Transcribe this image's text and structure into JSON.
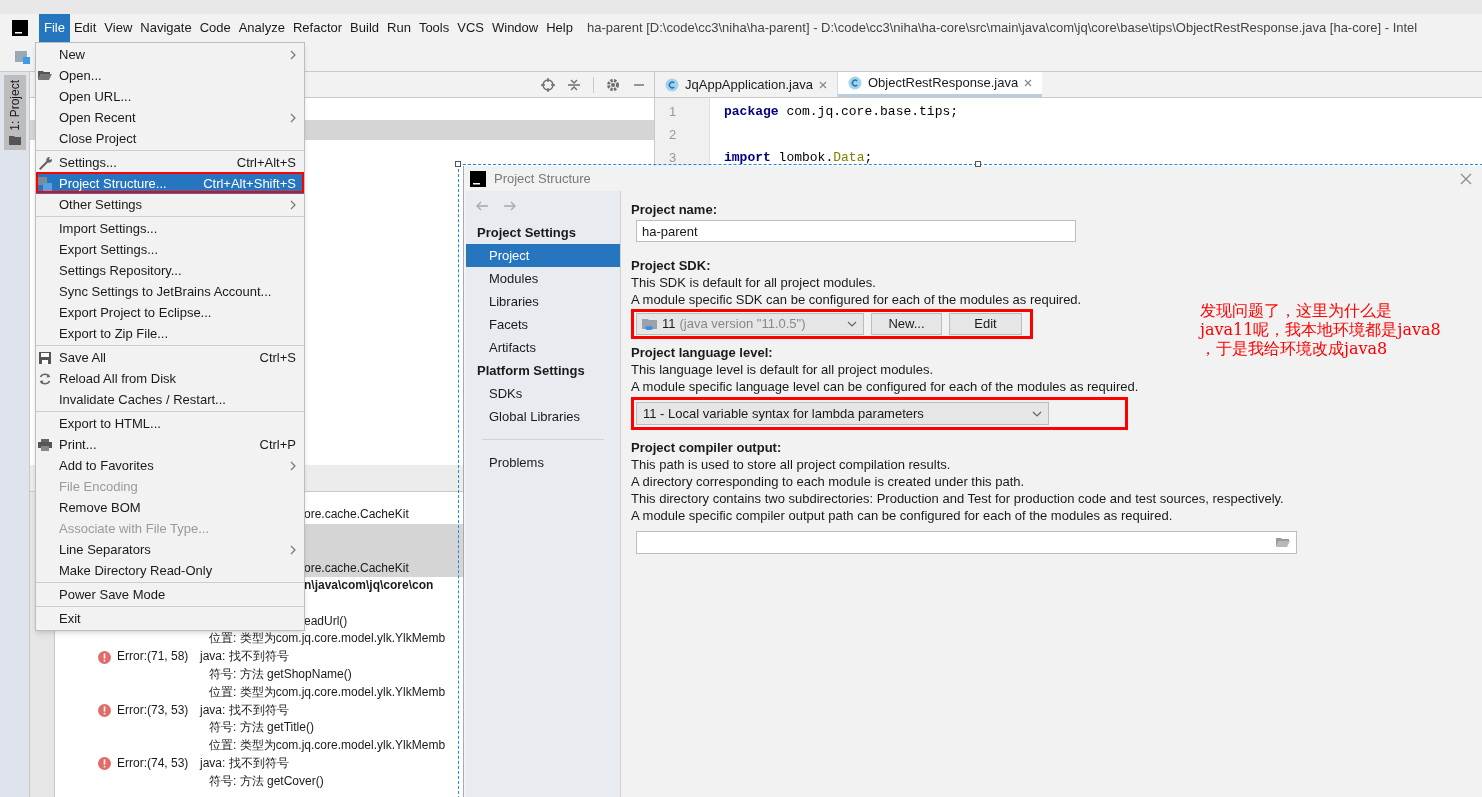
{
  "window": {
    "title": "ha-parent [D:\\code\\cc3\\niha\\ha-parent] - D:\\code\\cc3\\niha\\ha-core\\src\\main\\java\\com\\jq\\core\\base\\tips\\ObjectRestResponse.java [ha-core] - Intel"
  },
  "menu_bar": [
    {
      "label": "File",
      "selected": true
    },
    {
      "label": "Edit",
      "selected": false
    },
    {
      "label": "View",
      "selected": false
    },
    {
      "label": "Navigate",
      "selected": false
    },
    {
      "label": "Code",
      "selected": false
    },
    {
      "label": "Analyze",
      "selected": false
    },
    {
      "label": "Refactor",
      "selected": false
    },
    {
      "label": "Build",
      "selected": false
    },
    {
      "label": "Run",
      "selected": false
    },
    {
      "label": "Tools",
      "selected": false
    },
    {
      "label": "VCS",
      "selected": false
    },
    {
      "label": "Window",
      "selected": false
    },
    {
      "label": "Help",
      "selected": false
    }
  ],
  "tool_window_tab": {
    "label": "1: Project",
    "selected": true
  },
  "editor_tabs": [
    {
      "label": "JqAppApplication.java",
      "selected": false
    },
    {
      "label": "ObjectRestResponse.java",
      "selected": true
    }
  ],
  "editor_lines": [
    {
      "number": "1",
      "tokens": [
        {
          "text": "package",
          "kind": "keyword"
        },
        {
          "text": " com.jq.core.base.tips;",
          "kind": "plain"
        }
      ]
    },
    {
      "number": "2"
    },
    {
      "number": "3",
      "tokens": [
        {
          "text": "import",
          "kind": "keyword"
        },
        {
          "text": " lombok.",
          "kind": "plain"
        },
        {
          "text": "Data",
          "kind": "annotation"
        },
        {
          "text": ";",
          "kind": "plain"
        }
      ]
    }
  ],
  "build_output": [
    {
      "kind": "text",
      "text": "ore.cache.CacheKit",
      "selected": false
    },
    {
      "kind": "text",
      "text": "ore.cache.CacheKit",
      "selected": true
    },
    {
      "kind": "path",
      "text": "n\\java\\com\\jq\\core\\con",
      "selected": false
    },
    {
      "kind": "text",
      "text": "eadUrl()",
      "selected": false
    },
    {
      "kind": "detail",
      "text": "位置: 类型为com.jq.core.model.ylk.YlkMemb",
      "selected": false
    },
    {
      "kind": "error",
      "location": "Error:(71, 58)",
      "message": "java: 找不到符号",
      "selected": false
    },
    {
      "kind": "detail",
      "text": "符号:   方法 getShopName()",
      "selected": false
    },
    {
      "kind": "detail",
      "text": "位置: 类型为com.jq.core.model.ylk.YlkMemb",
      "selected": false
    },
    {
      "kind": "error",
      "location": "Error:(73, 53)",
      "message": "java: 找不到符号",
      "selected": false
    },
    {
      "kind": "detail",
      "text": "符号:   方法 getTitle()",
      "selected": false
    },
    {
      "kind": "detail",
      "text": "位置: 类型为com.jq.core.model.ylk.YlkMemb",
      "selected": false
    },
    {
      "kind": "error",
      "location": "Error:(74, 53)",
      "message": "java: 找不到符号",
      "selected": false
    },
    {
      "kind": "detail",
      "text": "符号:   方法 getCover()",
      "selected": false
    }
  ],
  "file_menu": [
    {
      "kind": "item",
      "label": "New",
      "submenu": true,
      "disabled": false,
      "selected": false
    },
    {
      "kind": "item",
      "label": "Open...",
      "submenu": false,
      "disabled": false,
      "selected": false
    },
    {
      "kind": "item",
      "label": "Open URL...",
      "submenu": false,
      "disabled": false,
      "selected": false
    },
    {
      "kind": "item",
      "label": "Open Recent",
      "submenu": true,
      "disabled": false,
      "selected": false
    },
    {
      "kind": "item",
      "label": "Close Project",
      "submenu": false,
      "disabled": false,
      "selected": false
    },
    {
      "kind": "separator"
    },
    {
      "kind": "item",
      "label": "Settings...",
      "shortcut": "Ctrl+Alt+S",
      "submenu": false,
      "disabled": false,
      "selected": false
    },
    {
      "kind": "item",
      "label": "Project Structure...",
      "shortcut": "Ctrl+Alt+Shift+S",
      "submenu": false,
      "disabled": false,
      "selected": true
    },
    {
      "kind": "item",
      "label": "Other Settings",
      "submenu": true,
      "disabled": false,
      "selected": false
    },
    {
      "kind": "separator"
    },
    {
      "kind": "item",
      "label": "Import Settings...",
      "submenu": false,
      "disabled": false,
      "selected": false
    },
    {
      "kind": "item",
      "label": "Export Settings...",
      "submenu": false,
      "disabled": false,
      "selected": false
    },
    {
      "kind": "item",
      "label": "Settings Repository...",
      "submenu": false,
      "disabled": false,
      "selected": false
    },
    {
      "kind": "item",
      "label": "Sync Settings to JetBrains Account...",
      "submenu": false,
      "disabled": false,
      "selected": false
    },
    {
      "kind": "item",
      "label": "Export Project to Eclipse...",
      "submenu": false,
      "disabled": false,
      "selected": false
    },
    {
      "kind": "item",
      "label": "Export to Zip File...",
      "submenu": false,
      "disabled": false,
      "selected": false
    },
    {
      "kind": "separator"
    },
    {
      "kind": "item",
      "label": "Save All",
      "shortcut": "Ctrl+S",
      "submenu": false,
      "disabled": false,
      "selected": false
    },
    {
      "kind": "item",
      "label": "Reload All from Disk",
      "submenu": false,
      "disabled": false,
      "selected": false
    },
    {
      "kind": "item",
      "label": "Invalidate Caches / Restart...",
      "submenu": false,
      "disabled": false,
      "selected": false
    },
    {
      "kind": "separator"
    },
    {
      "kind": "item",
      "label": "Export to HTML...",
      "submenu": false,
      "disabled": false,
      "selected": false
    },
    {
      "kind": "item",
      "label": "Print...",
      "shortcut": "Ctrl+P",
      "submenu": false,
      "disabled": false,
      "selected": false
    },
    {
      "kind": "item",
      "label": "Add to Favorites",
      "submenu": true,
      "disabled": false,
      "selected": false
    },
    {
      "kind": "item",
      "label": "File Encoding",
      "submenu": false,
      "disabled": true,
      "selected": false
    },
    {
      "kind": "item",
      "label": "Remove BOM",
      "submenu": false,
      "disabled": false,
      "selected": false
    },
    {
      "kind": "item",
      "label": "Associate with File Type...",
      "submenu": false,
      "disabled": true,
      "selected": false
    },
    {
      "kind": "item",
      "label": "Line Separators",
      "submenu": true,
      "disabled": false,
      "selected": false
    },
    {
      "kind": "item",
      "label": "Make Directory Read-Only",
      "submenu": false,
      "disabled": false,
      "selected": false
    },
    {
      "kind": "separator"
    },
    {
      "kind": "item",
      "label": "Power Save Mode",
      "submenu": false,
      "disabled": false,
      "selected": false
    },
    {
      "kind": "separator"
    },
    {
      "kind": "item",
      "label": "Exit",
      "submenu": false,
      "disabled": false,
      "selected": false
    }
  ],
  "dialog": {
    "title": "Project Structure",
    "nav": [
      {
        "kind": "heading",
        "label": "Project Settings"
      },
      {
        "kind": "item",
        "label": "Project",
        "selected": true
      },
      {
        "kind": "item",
        "label": "Modules",
        "selected": false
      },
      {
        "kind": "item",
        "label": "Libraries",
        "selected": false
      },
      {
        "kind": "item",
        "label": "Facets",
        "selected": false
      },
      {
        "kind": "item",
        "label": "Artifacts",
        "selected": false
      },
      {
        "kind": "heading",
        "label": "Platform Settings"
      },
      {
        "kind": "item",
        "label": "SDKs",
        "selected": false
      },
      {
        "kind": "item",
        "label": "Global Libraries",
        "selected": false
      },
      {
        "kind": "separator"
      },
      {
        "kind": "item",
        "label": "Problems",
        "selected": false
      }
    ],
    "project_name": {
      "label": "Project name:",
      "value": "ha-parent"
    },
    "project_sdk": {
      "label": "Project SDK:",
      "lines": [
        "This SDK is default for all project modules.",
        "A module specific SDK can be configured for each of the modules as required."
      ],
      "version": "11",
      "detail": "(java version \"11.0.5\")",
      "buttons": [
        "New...",
        "Edit"
      ]
    },
    "language_level": {
      "label": "Project language level:",
      "lines": [
        "This language level is default for all project modules.",
        "A module specific language level can be configured for each of the modules as required."
      ],
      "value": "11 - Local variable syntax for lambda parameters"
    },
    "compiler_output": {
      "label": "Project compiler output:",
      "lines": [
        "This path is used to store all project compilation results.",
        "A directory corresponding to each module is created under this path.",
        "This directory contains two subdirectories: Production and Test for production code and test sources, respectively.",
        "A module specific compiler output path can be configured for each of the modules as required."
      ]
    }
  },
  "annotation": {
    "lines": [
      "发现问题了，这里为什么是",
      "java11呢，我本地环境都是java8",
      "，于是我给环境改成java8"
    ]
  }
}
